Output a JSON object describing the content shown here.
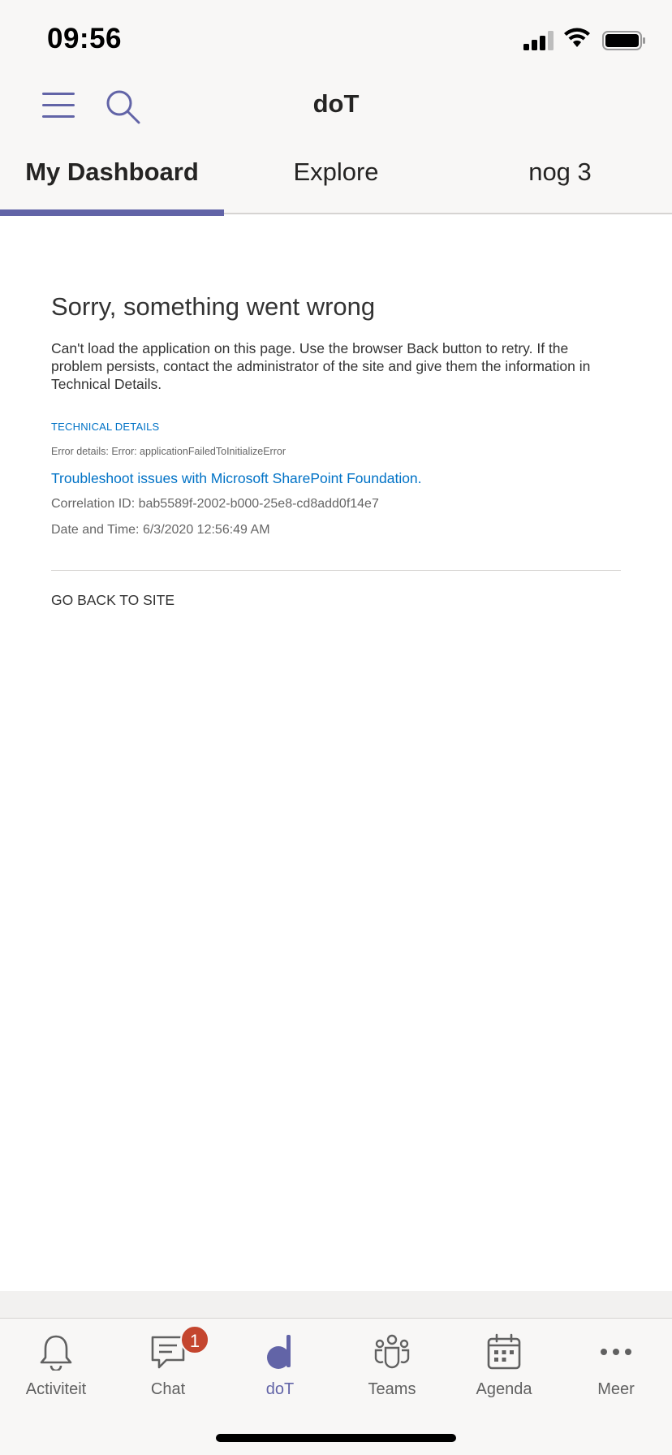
{
  "status_bar": {
    "time": "09:56"
  },
  "header": {
    "title": "doT",
    "tabs": [
      {
        "label": "My Dashboard",
        "active": true
      },
      {
        "label": "Explore",
        "active": false
      },
      {
        "label": "nog 3",
        "active": false
      }
    ]
  },
  "error": {
    "title": "Sorry, something went wrong",
    "message": "Can't load the application on this page. Use the browser Back button to retry. If the problem persists, contact the administrator of the site and give them the information in Technical Details.",
    "technical_heading": "TECHNICAL DETAILS",
    "error_details": "Error details: Error: applicationFailedToInitializeError",
    "troubleshoot_link": "Troubleshoot issues with Microsoft SharePoint Foundation.",
    "correlation_id": "Correlation ID: bab5589f-2002-b000-25e8-cd8add0f14e7",
    "date_time": "Date and Time: 6/3/2020 12:56:49 AM",
    "go_back": "GO BACK TO SITE"
  },
  "bottom_nav": {
    "items": [
      {
        "label": "Activiteit",
        "icon": "bell-icon"
      },
      {
        "label": "Chat",
        "icon": "chat-icon",
        "badge": "1"
      },
      {
        "label": "doT",
        "icon": "dot-app-icon",
        "active": true
      },
      {
        "label": "Teams",
        "icon": "teams-icon"
      },
      {
        "label": "Agenda",
        "icon": "calendar-icon"
      },
      {
        "label": "Meer",
        "icon": "more-icon"
      }
    ]
  },
  "colors": {
    "accent": "#6264a7",
    "link": "#0072c6",
    "badge": "#c4452e"
  }
}
